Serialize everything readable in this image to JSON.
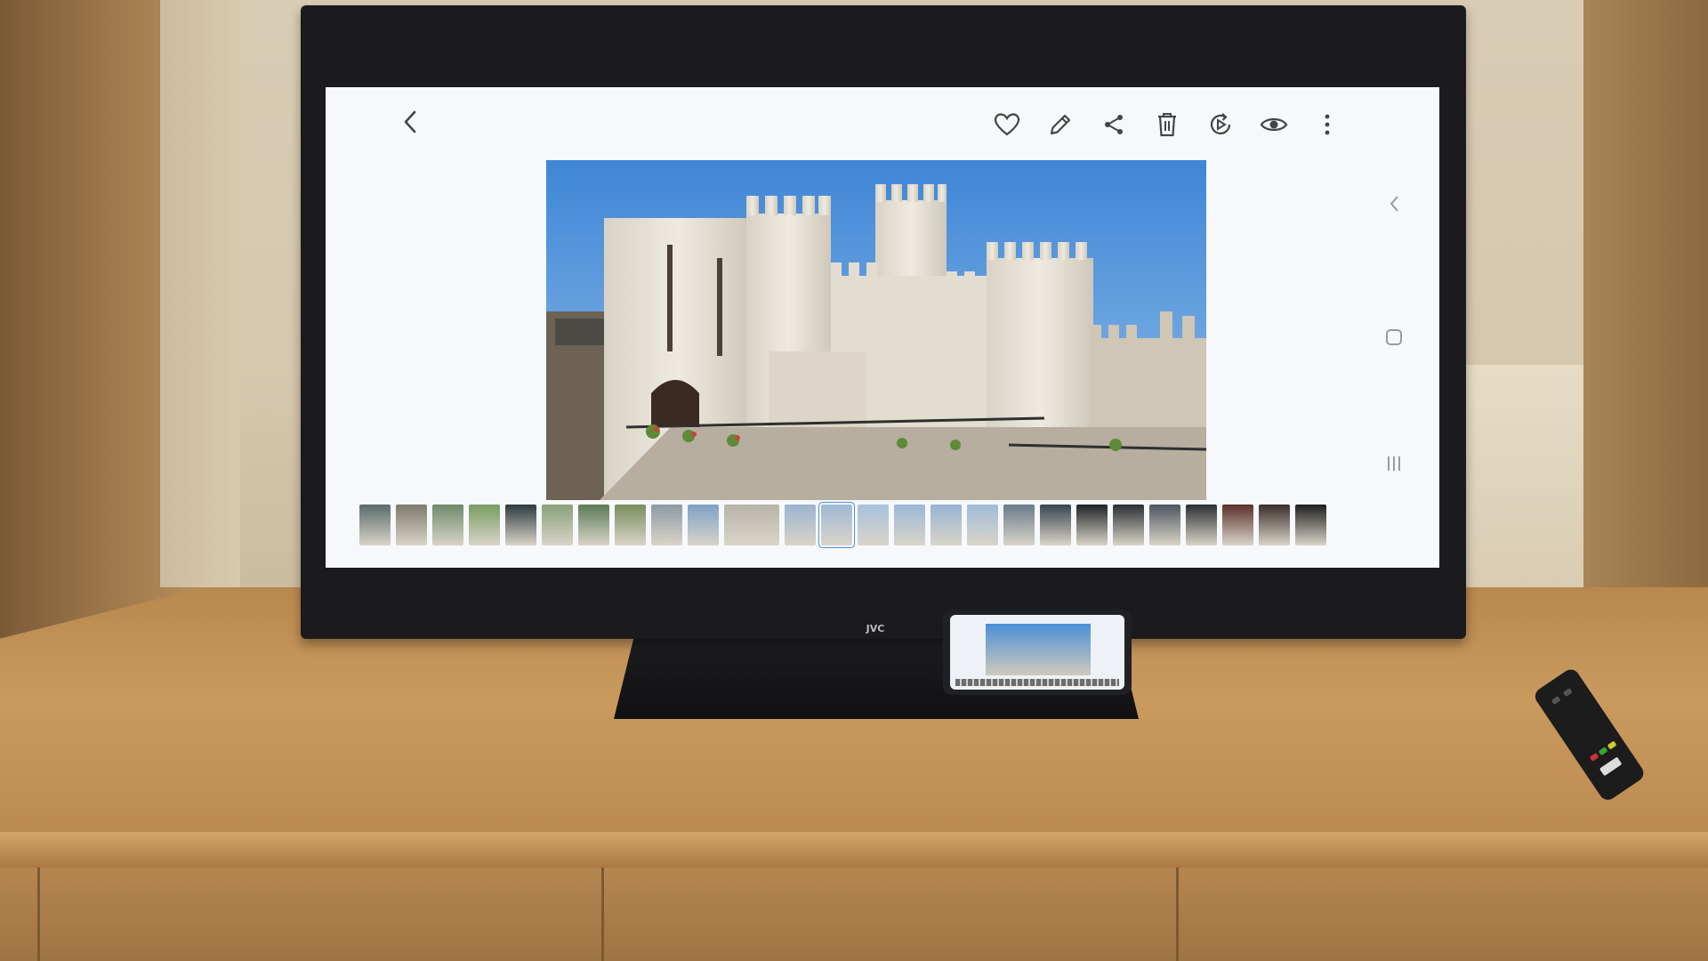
{
  "scene": {
    "description_tags": [
      "tv",
      "gallery-app",
      "castle-photo",
      "phone",
      "remote",
      "wood-cabinet"
    ]
  },
  "tv": {
    "brand_logo": "JVC"
  },
  "gallery": {
    "toolbar": [
      {
        "name": "favorite-button",
        "icon": "heart-icon"
      },
      {
        "name": "edit-button",
        "icon": "pencil-icon"
      },
      {
        "name": "share-button",
        "icon": "share-icon"
      },
      {
        "name": "delete-button",
        "icon": "trash-icon"
      },
      {
        "name": "remaster-button",
        "icon": "remaster-icon"
      },
      {
        "name": "view-button",
        "icon": "eye-icon"
      },
      {
        "name": "more-button",
        "icon": "more-vertical-icon"
      }
    ],
    "nav": {
      "back_icon": "chevron-left-icon",
      "side_back_icon": "chevron-left-icon",
      "side_home_icon": "square-icon",
      "side_recents_icon": "recents-icon"
    },
    "thumbnails": [
      {
        "color": "#5a6a6a"
      },
      {
        "color": "#7d7a6c"
      },
      {
        "color": "#6f8a6a"
      },
      {
        "color": "#789c62"
      },
      {
        "color": "#2f3a3f"
      },
      {
        "color": "#8aa07a"
      },
      {
        "color": "#5b7a55"
      },
      {
        "color": "#7b8d5e"
      },
      {
        "color": "#8e9aa4"
      },
      {
        "color": "#7ea1c6"
      },
      {
        "color": "#b7b4aa",
        "wide": true
      },
      {
        "color": "#9bb4cf"
      },
      {
        "color": "#9fb9d6",
        "current": true
      },
      {
        "color": "#a8c1dc"
      },
      {
        "color": "#9cb7d8"
      },
      {
        "color": "#97b3d5"
      },
      {
        "color": "#a2bcd9"
      },
      {
        "color": "#6a7b8c"
      },
      {
        "color": "#3a4450"
      },
      {
        "color": "#1f2327"
      },
      {
        "color": "#2a2e33"
      },
      {
        "color": "#4e5560"
      },
      {
        "color": "#2b2f34"
      },
      {
        "color": "#5b2f2a"
      },
      {
        "color": "#3a2e2a"
      },
      {
        "color": "#1d1d1d"
      }
    ]
  },
  "colors": {
    "screen_bg": "#f6f8fb",
    "icon": "#444444",
    "sky_top": "#3f86d6",
    "stone": "#e9e4da",
    "stone_shadow": "#bdb6a8"
  }
}
